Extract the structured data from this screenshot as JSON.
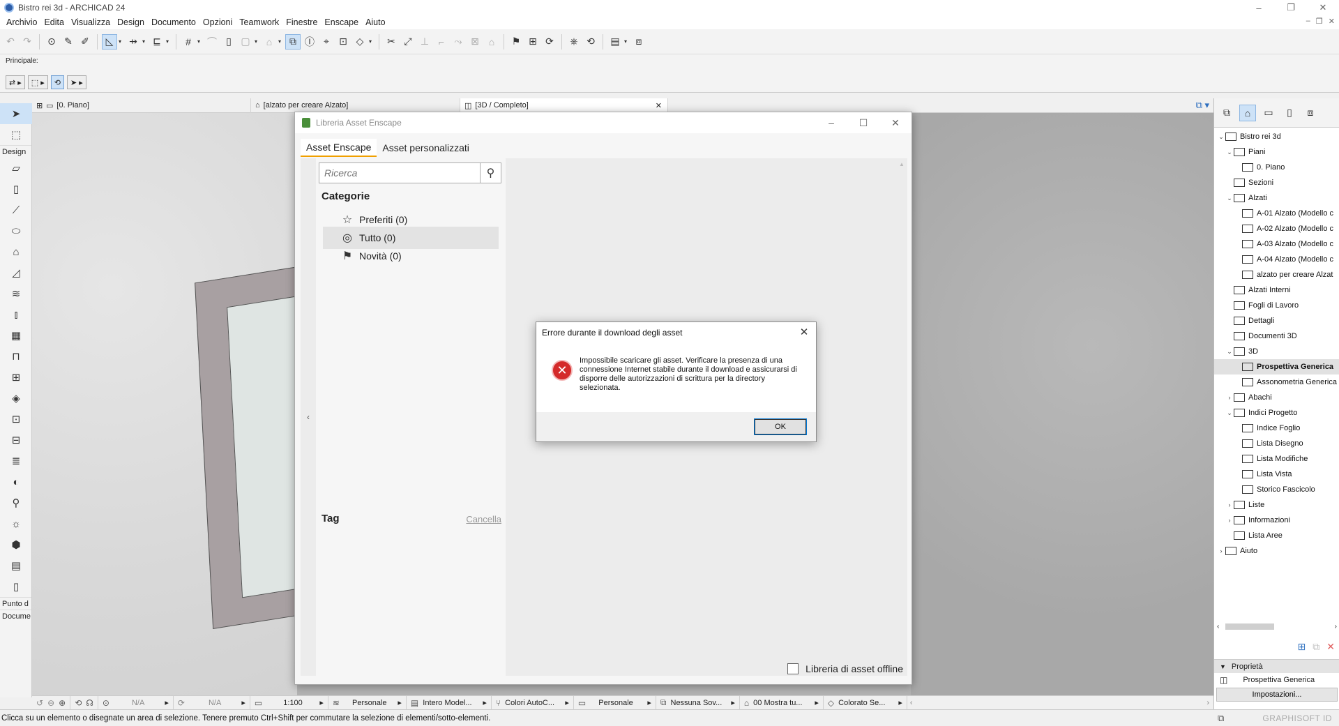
{
  "window": {
    "title": "Bistro rei 3d - ARCHICAD 24",
    "controls": [
      "–",
      "❐",
      "✕"
    ]
  },
  "menubar": {
    "items": [
      "Archivio",
      "Edita",
      "Visualizza",
      "Design",
      "Documento",
      "Opzioni",
      "Teamwork",
      "Finestre",
      "Enscape",
      "Aiuto"
    ]
  },
  "infobox": {
    "label": "Principale:"
  },
  "toolbox": {
    "sections": {
      "design": "Design",
      "viewpoint": "Punto d",
      "document": "Docume"
    }
  },
  "view_tabs": [
    {
      "label": "[0. Piano]"
    },
    {
      "label": "[alzato per creare Alzato]"
    },
    {
      "label": "[3D / Completo]",
      "close": "✕"
    }
  ],
  "navbar": {
    "zoom_value1": "N/A",
    "zoom_value2": "N/A",
    "scale": "1:100",
    "layer": "Personale",
    "model_view": "Intero Model...",
    "pen_set": "Colori AutoC...",
    "override": "Personale",
    "renovation": "Nessuna Sov...",
    "filter": "00 Mostra tu...",
    "graphic": "Colorato Se..."
  },
  "statusbar": {
    "message": "Clicca su un elemento o disegnate un area di selezione. Tenere premuto Ctrl+Shift per commutare la selezione di elementi/sotto-elementi.",
    "brand": "GRAPHISOFT ID"
  },
  "navigator": {
    "tree": [
      {
        "label": "Bistro rei 3d",
        "level": 0,
        "arrow": "⌄"
      },
      {
        "label": "Piani",
        "level": 1,
        "arrow": "⌄"
      },
      {
        "label": "0. Piano",
        "level": 2,
        "arrow": ""
      },
      {
        "label": "Sezioni",
        "level": 1,
        "arrow": ""
      },
      {
        "label": "Alzati",
        "level": 1,
        "arrow": "⌄"
      },
      {
        "label": "A-01 Alzato (Modello c",
        "level": 2,
        "arrow": ""
      },
      {
        "label": "A-02 Alzato (Modello c",
        "level": 2,
        "arrow": ""
      },
      {
        "label": "A-03 Alzato (Modello c",
        "level": 2,
        "arrow": ""
      },
      {
        "label": "A-04 Alzato (Modello c",
        "level": 2,
        "arrow": ""
      },
      {
        "label": "alzato per creare Alzat",
        "level": 2,
        "arrow": ""
      },
      {
        "label": "Alzati Interni",
        "level": 1,
        "arrow": ""
      },
      {
        "label": "Fogli di Lavoro",
        "level": 1,
        "arrow": ""
      },
      {
        "label": "Dettagli",
        "level": 1,
        "arrow": ""
      },
      {
        "label": "Documenti 3D",
        "level": 1,
        "arrow": ""
      },
      {
        "label": "3D",
        "level": 1,
        "arrow": "⌄"
      },
      {
        "label": "Prospettiva Generica",
        "level": 2,
        "arrow": "",
        "selected": true
      },
      {
        "label": "Assonometria Generica",
        "level": 2,
        "arrow": ""
      },
      {
        "label": "Abachi",
        "level": 1,
        "arrow": "›"
      },
      {
        "label": "Indici Progetto",
        "level": 1,
        "arrow": "⌄"
      },
      {
        "label": "Indice Foglio",
        "level": 2,
        "arrow": ""
      },
      {
        "label": "Lista Disegno",
        "level": 2,
        "arrow": ""
      },
      {
        "label": "Lista Modifiche",
        "level": 2,
        "arrow": ""
      },
      {
        "label": "Lista Vista",
        "level": 2,
        "arrow": ""
      },
      {
        "label": "Storico Fascicolo",
        "level": 2,
        "arrow": ""
      },
      {
        "label": "Liste",
        "level": 1,
        "arrow": "›"
      },
      {
        "label": "Informazioni",
        "level": 1,
        "arrow": "›"
      },
      {
        "label": "Lista Aree",
        "level": 1,
        "arrow": ""
      },
      {
        "label": "Aiuto",
        "level": 0,
        "arrow": "›"
      }
    ],
    "properties_header": "Proprietà",
    "properties_value": "Prospettiva Generica",
    "settings_button": "Impostazioni..."
  },
  "enscape": {
    "title": "Libreria Asset Enscape",
    "controls": [
      "–",
      "☐",
      "✕"
    ],
    "tabs": [
      "Asset Enscape",
      "Asset personalizzati"
    ],
    "search_placeholder": "Ricerca",
    "categories_header": "Categorie",
    "categories": [
      {
        "label": "Preferiti (0)",
        "icon": "☆"
      },
      {
        "label": "Tutto (0)",
        "icon": "◎",
        "selected": true
      },
      {
        "label": "Novità (0)",
        "icon": "⚑"
      }
    ],
    "tag_header": "Tag",
    "tag_clear": "Cancella",
    "offline_label": "Libreria di asset offline",
    "sidebar_toggle": "‹"
  },
  "error_dialog": {
    "title": "Errore durante il download degli asset",
    "message": "Impossibile scaricare gli asset. Verificare la presenza di una connessione Internet stabile durante il download e assicurarsi di disporre delle autorizzazioni di scrittura per la directory selezionata.",
    "ok_label": "OK",
    "close": "✕",
    "icon_glyph": "✕"
  },
  "colors": {
    "accent": "#0078d7",
    "selection": "#cde2f7",
    "error": "#d42a2a",
    "enscape_tab_underline": "#f0a000"
  }
}
